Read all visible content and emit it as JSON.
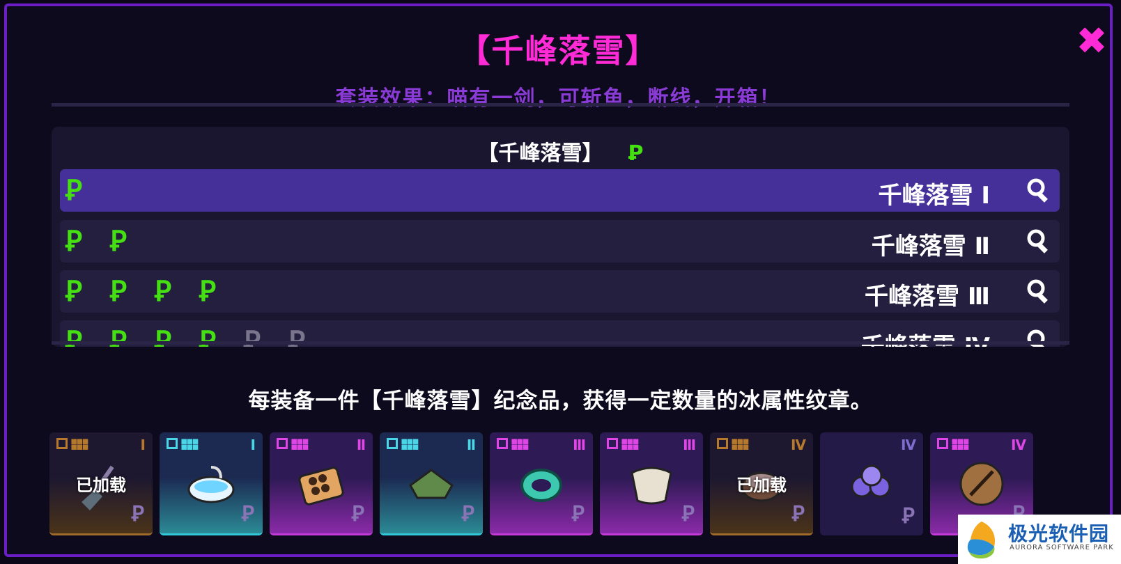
{
  "title": "【千峰落雪】",
  "close_label": "✖",
  "subtitle": "套装效果：喵有一剑，可斩鱼，断线，开箱！",
  "set_panel": {
    "header": "【千峰落雪】",
    "set_icon": "Ꝑ",
    "rows": [
      {
        "label": "千峰落雪 I",
        "active_icons": 1,
        "total_icons": 1,
        "selected": true
      },
      {
        "label": "千峰落雪 Ⅱ",
        "active_icons": 2,
        "total_icons": 2,
        "selected": false
      },
      {
        "label": "千峰落雪 Ⅲ",
        "active_icons": 4,
        "total_icons": 4,
        "selected": false
      },
      {
        "label": "千峰落雪 Ⅳ",
        "active_icons": 4,
        "total_icons": 6,
        "selected": false
      }
    ]
  },
  "description": "每装备一件【千峰落雪】纪念品，获得一定数量的冰属性纹章。",
  "cards": [
    {
      "rarity": "brown",
      "roman": "I",
      "status": "已加载",
      "item": "broom-icon"
    },
    {
      "rarity": "cyan",
      "roman": "I",
      "status": "",
      "item": "bathtub-icon"
    },
    {
      "rarity": "magenta",
      "roman": "Ⅱ",
      "status": "",
      "item": "choco-box-icon"
    },
    {
      "rarity": "cyan",
      "roman": "Ⅱ",
      "status": "",
      "item": "green-hat-icon"
    },
    {
      "rarity": "magenta",
      "roman": "Ⅲ",
      "status": "",
      "item": "jade-bracelet-icon"
    },
    {
      "rarity": "magenta",
      "roman": "Ⅲ",
      "status": "",
      "item": "paper-fan-icon"
    },
    {
      "rarity": "brown",
      "roman": "Ⅳ",
      "status": "已加载",
      "item": "bowl-icon"
    },
    {
      "rarity": "plain",
      "roman": "Ⅳ",
      "status": "",
      "item": "purple-balls-icon"
    },
    {
      "rarity": "magenta",
      "roman": "Ⅳ",
      "status": "",
      "item": "cookie-icon"
    }
  ],
  "watermark": {
    "cn": "极光软件园",
    "en": "AURORA SOFTWARE PARK"
  },
  "colors": {
    "accent": "#ff2bd6",
    "subtitle": "#8a3bd6",
    "active_icon": "#44e011",
    "selected_row": "#45309a"
  }
}
